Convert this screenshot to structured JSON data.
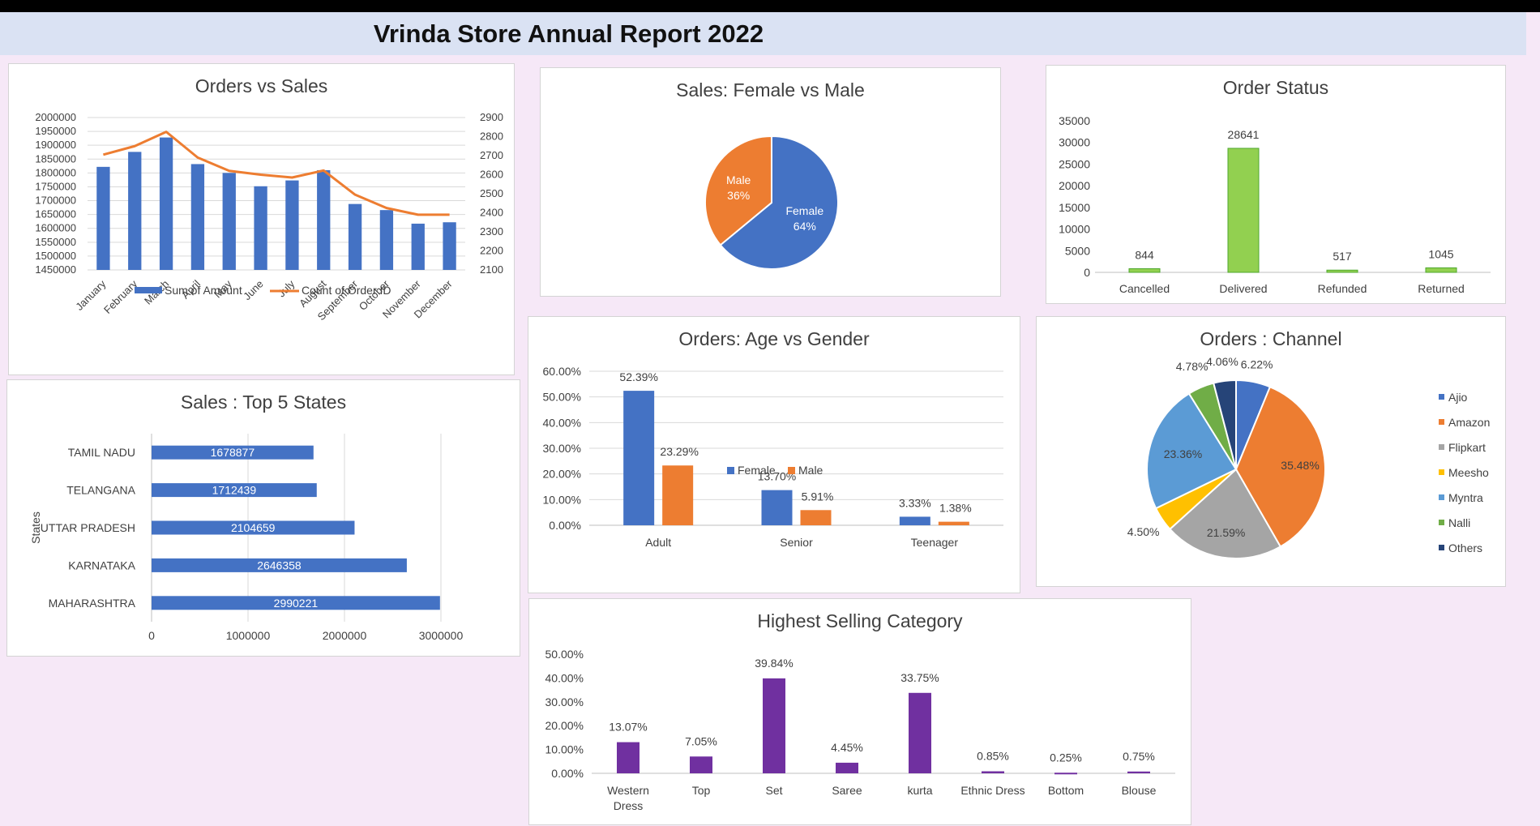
{
  "report_title": "Vrinda Store Annual Report 2022",
  "colors": {
    "blue": "#4472c4",
    "orange": "#ed7d31",
    "green": "#92d050",
    "purple": "#7030a0",
    "gray": "#a5a5a5",
    "yellow": "#ffc000",
    "lightblue": "#5b9bd5",
    "darkgreen": "#70ad47",
    "navy": "#264478"
  },
  "chart_data": [
    {
      "id": "orders_vs_sales",
      "type": "bar",
      "title": "Orders vs Sales",
      "categories": [
        "January",
        "February",
        "March",
        "April",
        "May",
        "June",
        "July",
        "August",
        "September",
        "October",
        "November",
        "December"
      ],
      "series": [
        {
          "name": "Sum of Amount",
          "type": "bar",
          "axis": "left",
          "values": [
            1822000,
            1876000,
            1928000,
            1832000,
            1800000,
            1752000,
            1773000,
            1810000,
            1688000,
            1666000,
            1617000,
            1622000
          ]
        },
        {
          "name": "Count of Order ID",
          "type": "line",
          "axis": "right",
          "values": [
            2705,
            2750,
            2825,
            2690,
            2620,
            2600,
            2585,
            2622,
            2495,
            2425,
            2390,
            2390
          ]
        }
      ],
      "y_left": {
        "min": 1450000,
        "max": 2000000,
        "step": 50000
      },
      "y_right": {
        "min": 2100,
        "max": 2900,
        "step": 100
      },
      "legend": "bottom"
    },
    {
      "id": "sales_gender",
      "type": "pie",
      "title": "Sales: Female vs Male",
      "labels": [
        "Female",
        "Male"
      ],
      "values": [
        64,
        36
      ],
      "display": [
        "64%",
        "36%"
      ]
    },
    {
      "id": "order_status",
      "type": "bar",
      "title": "Order Status",
      "categories": [
        "Cancelled",
        "Delivered",
        "Refunded",
        "Returned"
      ],
      "values": [
        844,
        28641,
        517,
        1045
      ],
      "ylim": [
        0,
        35000
      ],
      "step": 5000
    },
    {
      "id": "top_states",
      "type": "bar",
      "orientation": "horizontal",
      "title": "Sales : Top 5 States",
      "ylabel": "States",
      "categories": [
        "TAMIL NADU",
        "TELANGANA",
        "UTTAR PRADESH",
        "KARNATAKA",
        "MAHARASHTRA"
      ],
      "values": [
        1678877,
        1712439,
        2104659,
        2646358,
        2990221
      ],
      "xlim": [
        0,
        3000000
      ],
      "step": 1000000
    },
    {
      "id": "age_gender",
      "type": "bar",
      "title": "Orders: Age vs Gender",
      "categories": [
        "Adult",
        "Senior",
        "Teenager"
      ],
      "series": [
        {
          "name": "Female",
          "values": [
            52.39,
            13.7,
            3.33
          ],
          "labels": [
            "52.39%",
            "13.70%",
            "3.33%"
          ]
        },
        {
          "name": "Male",
          "values": [
            23.29,
            5.91,
            1.38
          ],
          "labels": [
            "23.29%",
            "5.91%",
            "1.38%"
          ]
        }
      ],
      "ylim": [
        0,
        60
      ],
      "step": 10,
      "legend": "bottom"
    },
    {
      "id": "channel",
      "type": "pie",
      "title": "Orders : Channel",
      "labels": [
        "Ajio",
        "Amazon",
        "Flipkart",
        "Meesho",
        "Myntra",
        "Nalli",
        "Others"
      ],
      "values": [
        6.22,
        35.48,
        21.59,
        4.5,
        23.36,
        4.78,
        4.06
      ],
      "display": [
        "6.22%",
        "35.48%",
        "21.59%",
        "4.50%",
        "23.36%",
        "4.78%",
        "4.06%"
      ],
      "legend": "right"
    },
    {
      "id": "category",
      "type": "bar",
      "title": "Highest Selling Category",
      "categories": [
        [
          "Western",
          "Dress"
        ],
        [
          "Top"
        ],
        [
          "Set"
        ],
        [
          "Saree"
        ],
        [
          "kurta"
        ],
        [
          "Ethnic Dress"
        ],
        [
          "Bottom"
        ],
        [
          "Blouse"
        ]
      ],
      "values": [
        13.07,
        7.05,
        39.84,
        4.45,
        33.75,
        0.85,
        0.25,
        0.75
      ],
      "labels": [
        "13.07%",
        "7.05%",
        "39.84%",
        "4.45%",
        "33.75%",
        "0.85%",
        "0.25%",
        "0.75%"
      ],
      "ylim": [
        0,
        50
      ],
      "step": 10
    }
  ]
}
